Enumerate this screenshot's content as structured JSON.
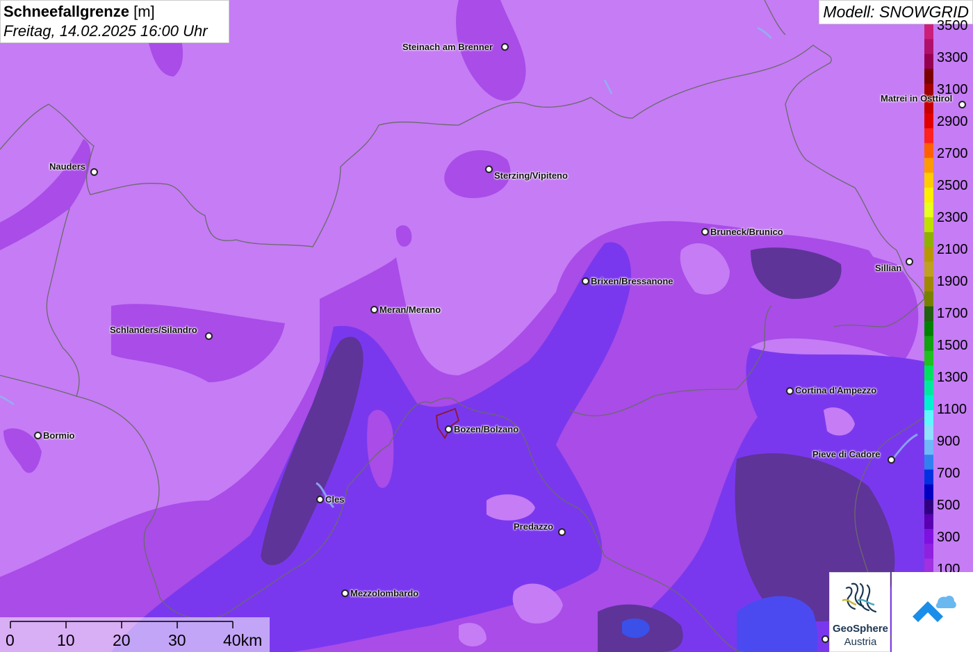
{
  "title": {
    "parameter": "Schneefallgrenze",
    "unit": "[m]",
    "datetime": "Freitag, 14.02.2025 16:00 Uhr"
  },
  "model": "Modell: SNOWGRID",
  "legend": {
    "labels": [
      "3500",
      "3300",
      "3100",
      "2900",
      "2700",
      "2500",
      "2300",
      "2100",
      "1900",
      "1700",
      "1500",
      "1300",
      "1100",
      "900",
      "700",
      "500",
      "300",
      "100"
    ],
    "colors": [
      "#cc1f7a",
      "#b0106a",
      "#960050",
      "#7a0000",
      "#a00000",
      "#c80000",
      "#e00000",
      "#ff2020",
      "#ff6000",
      "#ff9a00",
      "#ffcc00",
      "#ffee00",
      "#e8ff20",
      "#c0e000",
      "#90b000",
      "#b89800",
      "#c0a020",
      "#a08800",
      "#788000",
      "#206010",
      "#008000",
      "#10a010",
      "#20c020",
      "#00e060",
      "#00e8a0",
      "#00f0d0",
      "#60f8ff",
      "#90e0ff",
      "#70b8f8",
      "#3080f0",
      "#0030e0",
      "#0000c0",
      "#300080",
      "#5a00b0",
      "#8010e0",
      "#9020e0",
      "#a030e0"
    ]
  },
  "cities": [
    {
      "name": "Steinach am Brenner"
    },
    {
      "name": "Nauders"
    },
    {
      "name": "Sterzing/Vipiteno"
    },
    {
      "name": "Matrei in Osttirol"
    },
    {
      "name": "Bruneck/Brunico"
    },
    {
      "name": "Sillian"
    },
    {
      "name": "Brixen/Bressanone"
    },
    {
      "name": "Meran/Merano"
    },
    {
      "name": "Schlanders/Silandro"
    },
    {
      "name": "Cortina d'Ampezzo"
    },
    {
      "name": "Bormio"
    },
    {
      "name": "Bozen/Bolzano"
    },
    {
      "name": "Pieve di Cadore"
    },
    {
      "name": "Cles"
    },
    {
      "name": "Predazzo"
    },
    {
      "name": "Mezzolombardo"
    }
  ],
  "scale": {
    "labels": [
      "0",
      "10",
      "20",
      "30",
      "40km"
    ]
  },
  "logos": {
    "geosphere_line1": "GeoSphere",
    "geosphere_line2": "Austria"
  },
  "colors": {
    "above_1500": "#c57cf5",
    "band_300_500": "#8a3ee0",
    "band_100_300": "#7a30f0",
    "low_dark": "#5a2a9a",
    "below_100": "#4050f0",
    "borders": "#666666"
  }
}
